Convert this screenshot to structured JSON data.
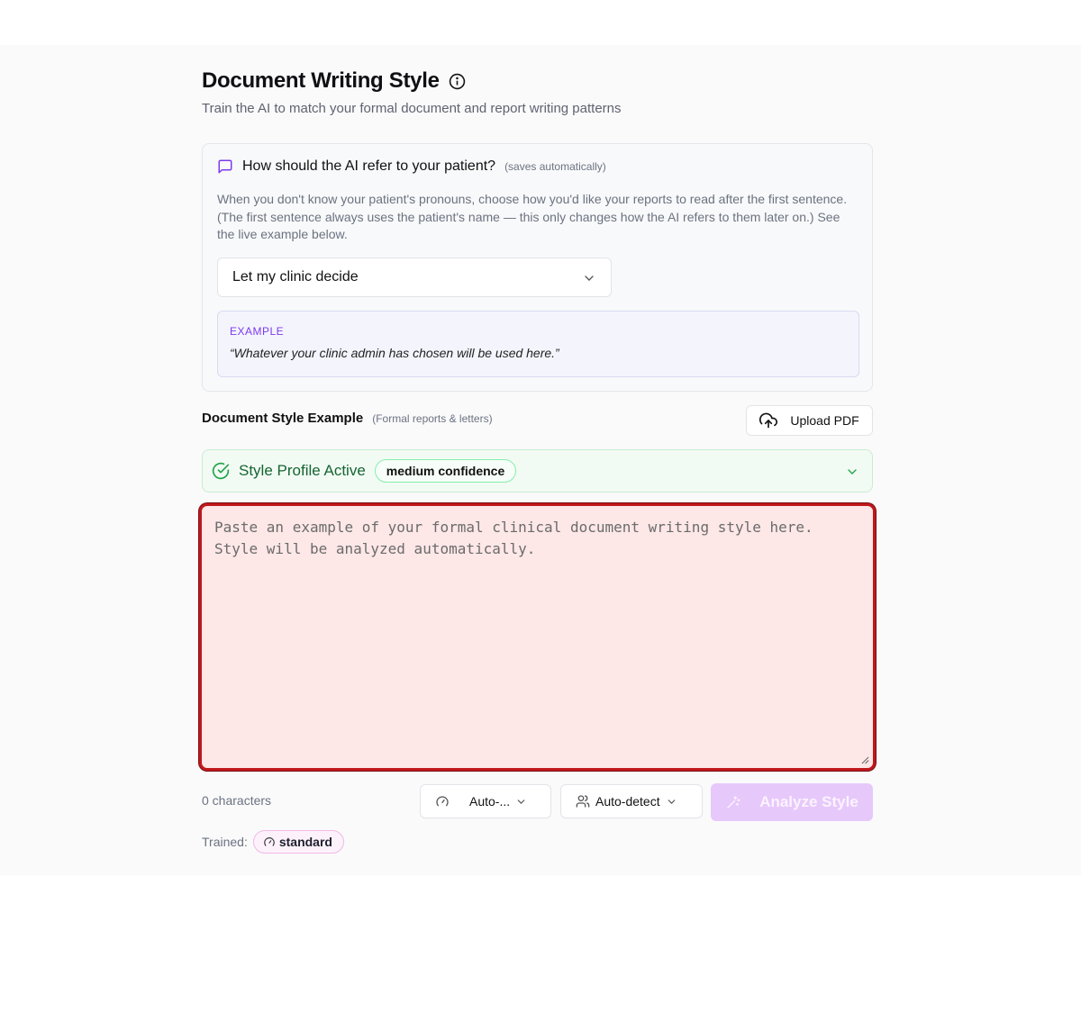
{
  "header": {
    "title": "Document Writing Style",
    "subtitle": "Train the AI to match your formal document and report writing patterns",
    "info_icon": "info-circle-icon"
  },
  "pronoun_card": {
    "question": "How should the AI refer to your patient?",
    "note": "(saves automatically)",
    "description": "When you don't know your patient's pronouns, choose how you'd like your reports to read after the first sentence. (The first sentence always uses the patient's name — this only changes how the AI refers to them later on.) See the live example below.",
    "select_value": "Let my clinic decide",
    "example_label": "Example",
    "example_text": "“Whatever your clinic admin has chosen will be used here.”",
    "accent_color": "#7c3aed"
  },
  "document_style": {
    "title": "Document Style Example",
    "note": "(Formal reports & letters)",
    "upload_label": "Upload PDF",
    "profile_status": "Style Profile Active",
    "confidence_label": "medium confidence",
    "textarea_placeholder": "Paste an example of your formal clinical document writing style here. Style will be analyzed automatically.",
    "textarea_value": "",
    "status_color": "#166534",
    "error_border_color": "#c0181c"
  },
  "controls": {
    "char_count": "0 characters",
    "speed_label": "Auto-...",
    "audience_label": "Auto-detect",
    "analyze_label": "Analyze Style",
    "analyze_color": "#e7c8fb"
  },
  "trained": {
    "label": "Trained:",
    "chip": "standard"
  }
}
